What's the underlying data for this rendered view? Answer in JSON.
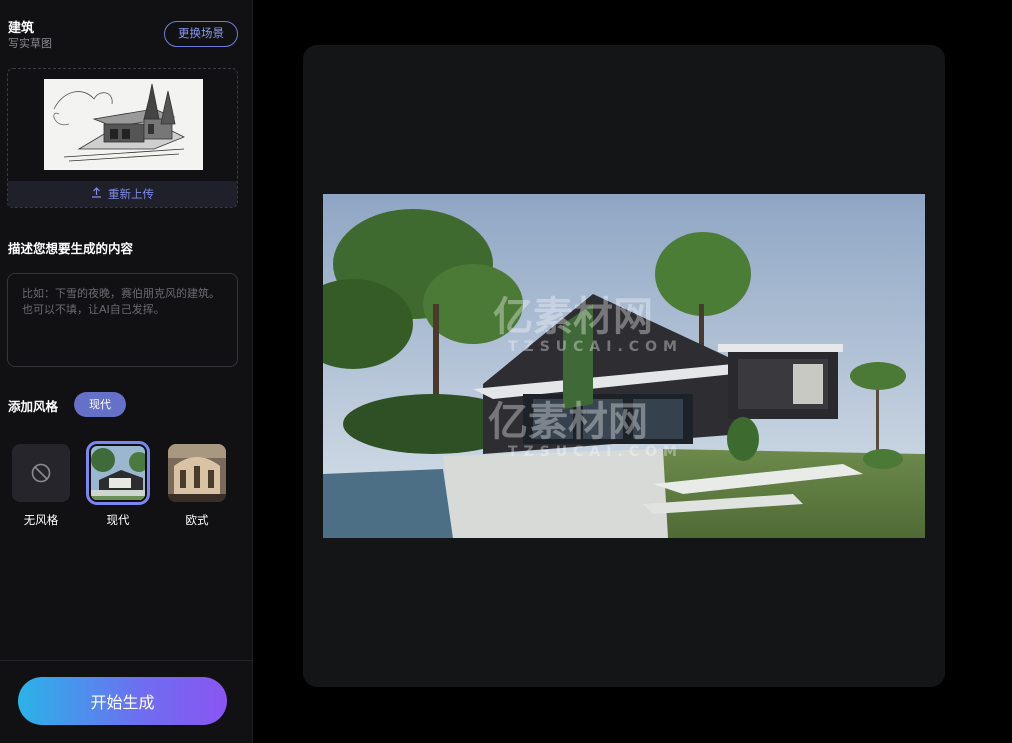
{
  "scene": {
    "title": "建筑",
    "subtitle": "写实草图",
    "change_label": "更换场景"
  },
  "upload": {
    "reupload_label": "重新上传",
    "icon": "upload-icon"
  },
  "description": {
    "label": "描述您想要生成的内容",
    "placeholder": "比如：下雪的夜晚，赛伯朋克风的建筑。也可以不填，让AI自己发挥。",
    "value": ""
  },
  "style": {
    "label": "添加风格",
    "selected": "现代",
    "options": [
      {
        "name": "无风格",
        "icon": "no-style-icon"
      },
      {
        "name": "现代"
      },
      {
        "name": "欧式"
      }
    ]
  },
  "actions": {
    "start_label": "开始生成"
  },
  "watermark": {
    "text": "亿素材网",
    "url": "TZSUCAI.COM"
  },
  "colors": {
    "accent": "#6f7bdc",
    "chip": "#6570c8",
    "gradient_start": "#2ab3e8",
    "gradient_end": "#8a55f2"
  }
}
